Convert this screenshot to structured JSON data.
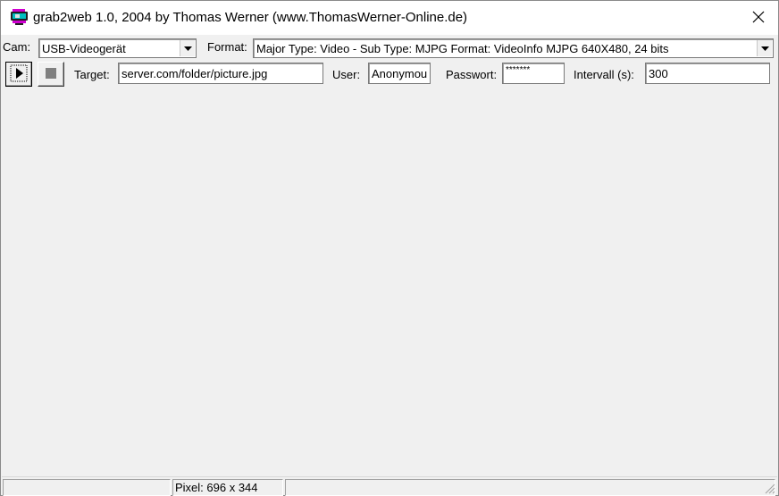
{
  "window": {
    "title": "grab2web 1.0, 2004 by Thomas Werner (www.ThomasWerner-Online.de)",
    "icon": "webcam-app-icon",
    "close_icon": "close-icon"
  },
  "toolbar": {
    "cam_label": "Cam:",
    "cam_value": "USB-Videogerät",
    "format_label": "Format:",
    "format_value": "Major Type: Video - Sub Type: MJPG Format: VideoInfo MJPG 640X480, 24 bits",
    "start_icon": "play-icon",
    "stop_icon": "stop-icon",
    "target_label": "Target:",
    "target_value": "server.com/folder/picture.jpg",
    "user_label": "User:",
    "user_value": "Anonymou",
    "password_label": "Passwort:",
    "password_value": "*******",
    "interval_label": "Intervall (s):",
    "interval_value": "300"
  },
  "statusbar": {
    "pane1": "",
    "pixel_text": "Pixel: 696 x 344",
    "pane3": ""
  }
}
